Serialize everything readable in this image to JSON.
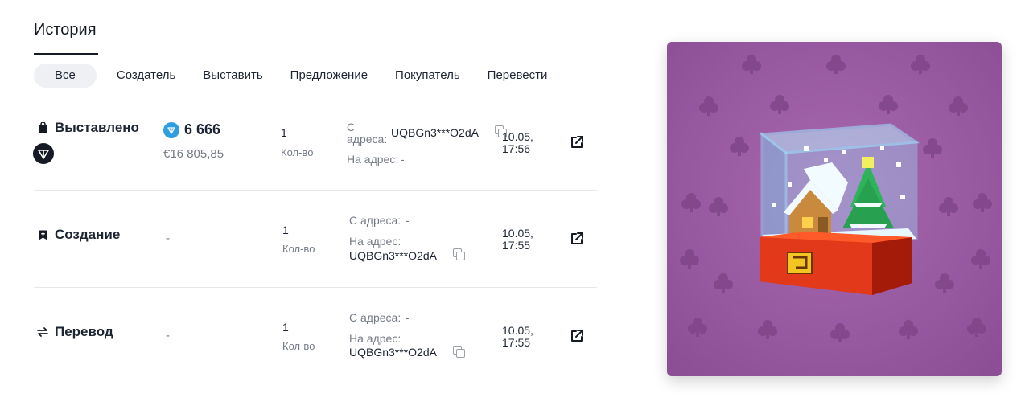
{
  "history": {
    "title": "История",
    "filters": [
      "Все",
      "Создатель",
      "Выставить",
      "Предложение",
      "Покупатель",
      "Перевести"
    ],
    "active_filter": "Все"
  },
  "events": [
    {
      "type": "Выставлено",
      "icon": "bag-icon",
      "price": "6 666",
      "fiat": "€16 805,85",
      "qty": "1",
      "qty_label": "Кол-во",
      "from_label": "С адреса:",
      "from_value": "UQBGn3***O2dA",
      "to_label": "На адрес:",
      "to_value": "-",
      "date": "10.05,",
      "time": "17:56"
    },
    {
      "type": "Создание",
      "icon": "bookmark-plus-icon",
      "price": "-",
      "qty": "1",
      "qty_label": "Кол-во",
      "from_label": "С адреса:",
      "from_value": "-",
      "to_label": "На адрес:",
      "to_value": "UQBGn3***O2dA",
      "date": "10.05,",
      "time": "17:55"
    },
    {
      "type": "Перевод",
      "icon": "transfer-arrows-icon",
      "price": "-",
      "qty": "1",
      "qty_label": "Кол-во",
      "from_label": "С адреса:",
      "from_value": "-",
      "to_label": "На адрес:",
      "to_value": "UQBGn3***O2dA",
      "date": "10.05,",
      "time": "17:55"
    }
  ],
  "colors": {
    "card_background": "#9a5aa3",
    "ton_blue": "#2f9ee0"
  },
  "nft_image": "snow-globe-house-tree-icon"
}
